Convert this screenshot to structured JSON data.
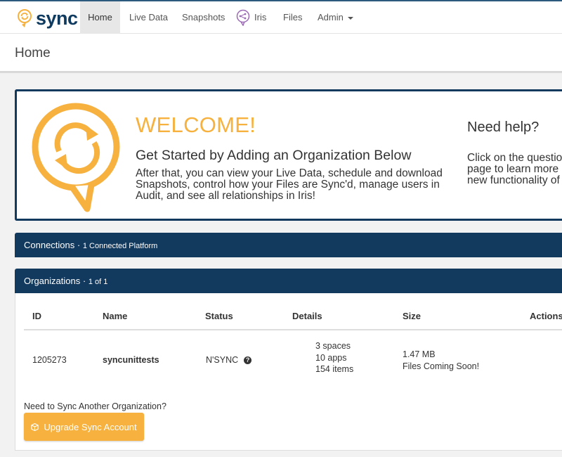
{
  "brand": {
    "name": "sync",
    "icon": "sync-logo-icon"
  },
  "nav": {
    "home": "Home",
    "live_data": "Live Data",
    "snapshots": "Snapshots",
    "iris": "Iris",
    "files": "Files",
    "admin": "Admin"
  },
  "page_title": "Home",
  "welcome": {
    "title": "WELCOME!",
    "subtitle": "Get Started by Adding an Organization Below",
    "body_lines": [
      "After that, you can view your Live Data, schedule and download",
      "Snapshots, control how your Files are Sync'd, manage users in",
      "Audit, and see all relationships in Iris!"
    ],
    "help_title": "Need help?",
    "help_lines": [
      "Click on the questio",
      "page to learn more",
      "new functionality of"
    ]
  },
  "connections": {
    "title": "Connections",
    "separator": "·",
    "count": "1 Connected Platform"
  },
  "organizations": {
    "title": "Organizations",
    "separator": "·",
    "count": "1 of 1",
    "columns": {
      "id": "ID",
      "name": "Name",
      "status": "Status",
      "details": "Details",
      "size": "Size",
      "actions": "Actions"
    },
    "rows": [
      {
        "id": "1205273",
        "name": "syncunittests",
        "status": "N'SYNC",
        "details": [
          "3 spaces",
          "10 apps",
          "154 items"
        ],
        "size": [
          "1.47 MB",
          "Files Coming Soon!"
        ]
      }
    ],
    "need_sync": "Need to Sync Another Organization?",
    "upgrade_button": "Upgrade Sync Account"
  },
  "colors": {
    "navy": "#12395e",
    "accent": "#f6b13e",
    "iris": "#9b6bb5"
  }
}
